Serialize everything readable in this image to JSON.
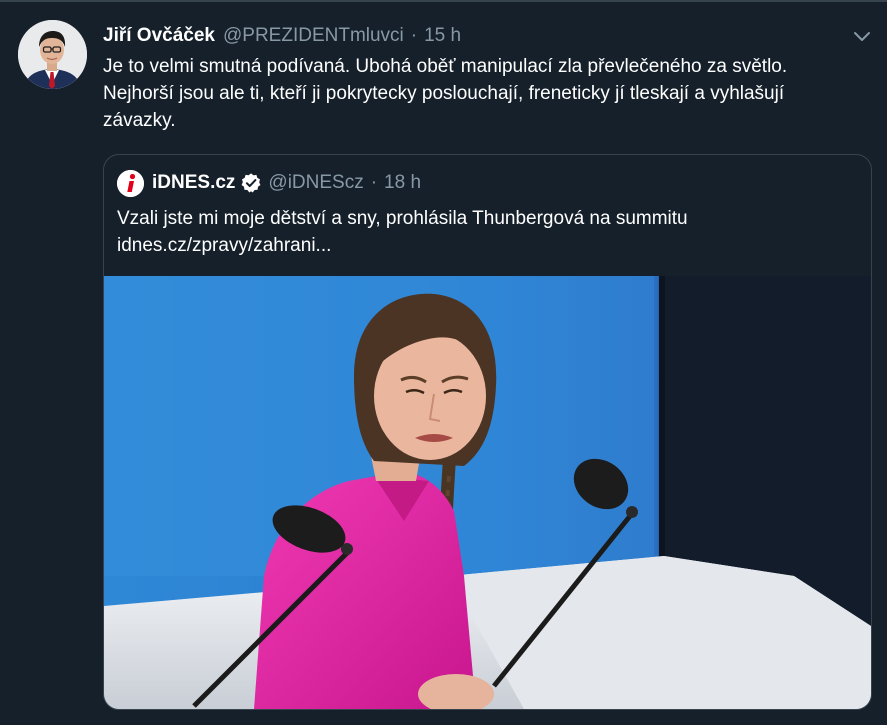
{
  "tweet": {
    "author_name": "Jiří Ovčáček",
    "author_handle": "@PREZIDENTmluvci",
    "separator": "·",
    "time": "15 h",
    "text_lines": [
      "Je to velmi smutná podívaná. Ubohá oběť manipulací zla převlečeného za světlo.",
      "Nejhorší jsou ale ti, kteří ji pokrytecky poslouchají, freneticky jí tleskají a vyhlašují",
      "závazky."
    ]
  },
  "quoted_tweet": {
    "author_name": "iDNES.cz",
    "author_handle": "@iDNEScz",
    "separator": "·",
    "time": "18 h",
    "text_line_1": "Vzali jste mi moje dětství a sny, prohlásila Thunbergová na summitu",
    "link_text": "idnes.cz/zpravy/zahrani..."
  },
  "colors": {
    "background": "#15202b",
    "border": "#38444d",
    "secondary_text": "#8899a6",
    "verified": "#ffffff",
    "brand_red": "#e2001a"
  },
  "icons": {
    "menu": "chevron-down-icon",
    "verified": "verified-badge-icon",
    "logo": "idnes-logo-icon"
  }
}
